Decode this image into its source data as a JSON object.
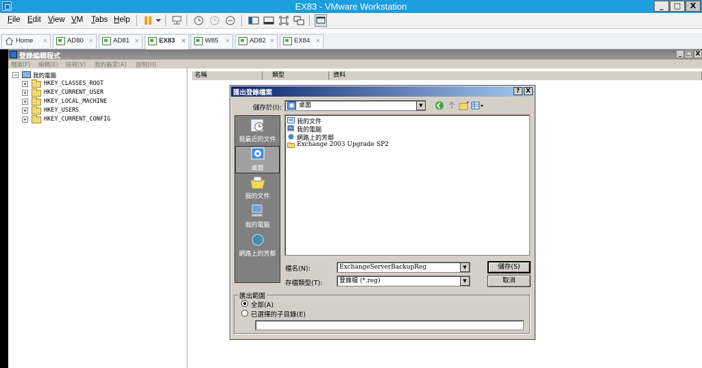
{
  "vmware": {
    "title": "EX83 - VMware Workstation",
    "window_buttons": [
      "_",
      "□",
      "X"
    ],
    "menu": [
      "File",
      "Edit",
      "View",
      "VM",
      "Tabs",
      "Help"
    ],
    "tabs": [
      {
        "label": "Home",
        "active": false
      },
      {
        "label": "AD80",
        "active": false
      },
      {
        "label": "AD81",
        "active": false
      },
      {
        "label": "EX83",
        "active": true
      },
      {
        "label": "W85",
        "active": false
      },
      {
        "label": "AD82",
        "active": false
      },
      {
        "label": "EX84",
        "active": false
      }
    ],
    "tab_close": "×"
  },
  "regedit": {
    "title": "登錄編輯程式",
    "window_buttons": [
      "_",
      "□",
      "X"
    ],
    "menu": [
      "檔案(F)",
      "編輯(E)",
      "檢視(V)",
      "我的最愛(A)",
      "說明(H)"
    ],
    "tree_root": "我的電腦",
    "tree_items": [
      "HKEY_CLASSES_ROOT",
      "HKEY_CURRENT_USER",
      "HKEY_LOCAL_MACHINE",
      "HKEY_USERS",
      "HKEY_CURRENT_CONFIG"
    ],
    "columns": [
      "名稱",
      "類型",
      "資料"
    ]
  },
  "dialog": {
    "title": "匯出登錄檔案",
    "help_btn": "?",
    "close_btn": "X",
    "save_in_label": "儲存於(I):",
    "save_in_value": "桌面",
    "places": [
      "我最近的文件",
      "桌面",
      "我的文件",
      "我的電腦",
      "網路上的芳鄰"
    ],
    "files": [
      "我的文件",
      "我的電腦",
      "網路上的芳鄰",
      "Exchange 2003 Upgrade SP2"
    ],
    "filename_label": "檔名(N):",
    "filename_value": "ExchangeServerBackupReg",
    "filetype_label": "存檔類型(T):",
    "filetype_value": "登錄檔 (*.reg)",
    "save_btn": "儲存(S)",
    "cancel_btn": "取消",
    "range_label": "匯出範圍",
    "range_all": "全部(A)",
    "range_branch": "已選擇的子目錄(E)",
    "branch_value": ""
  }
}
